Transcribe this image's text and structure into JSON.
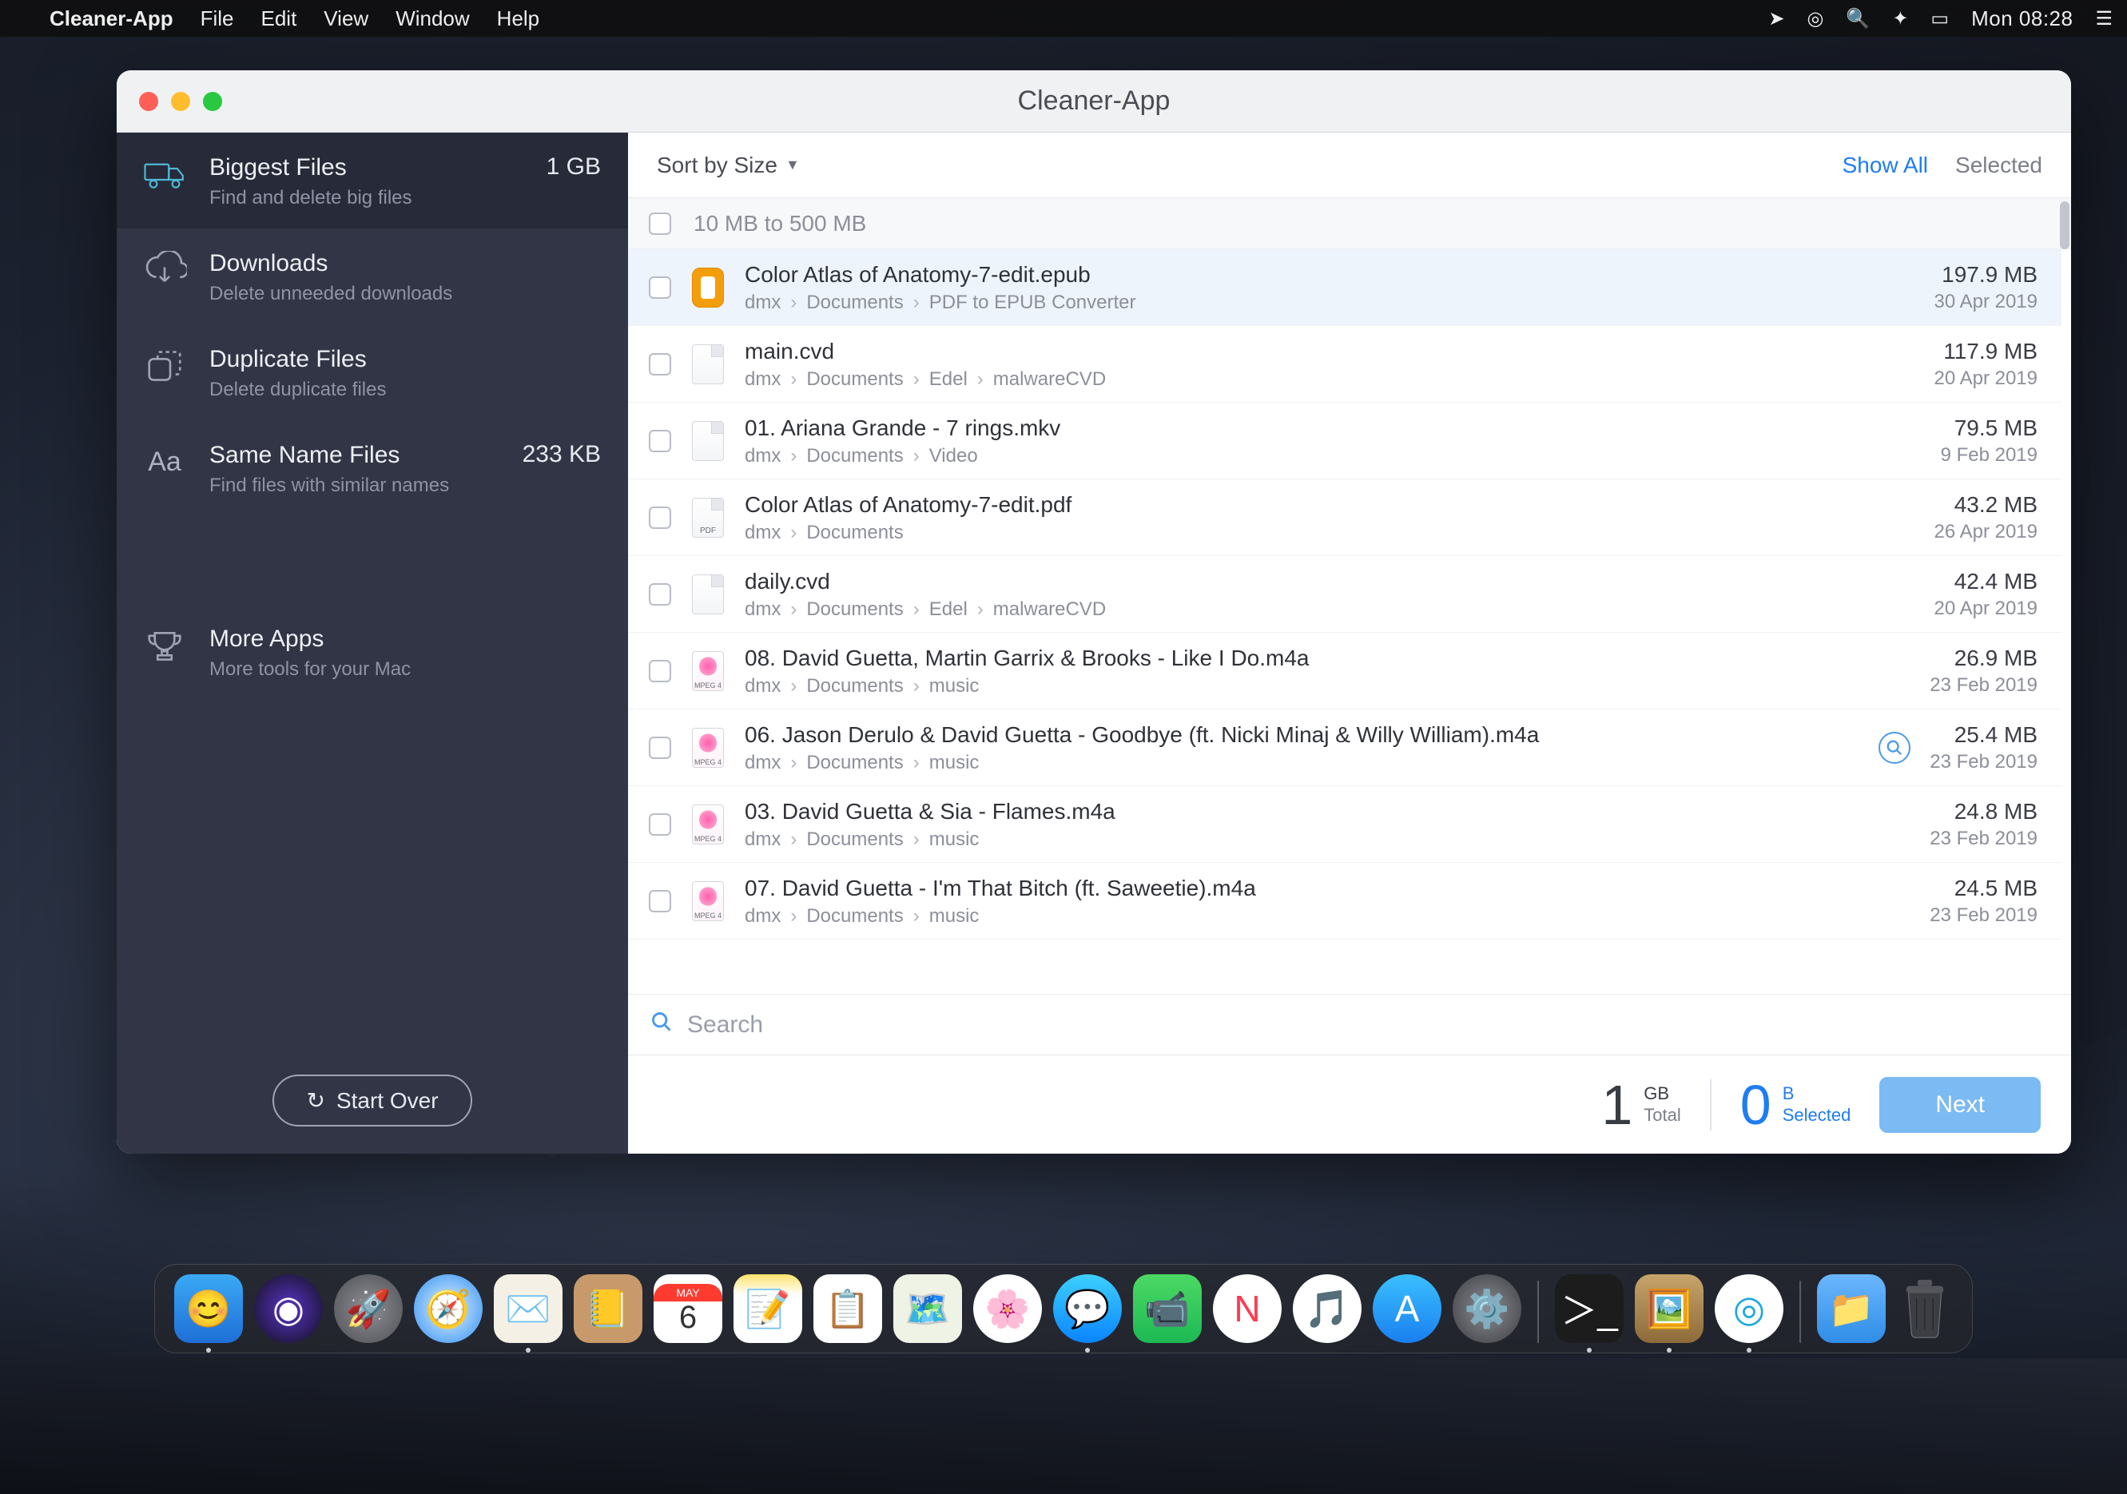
{
  "menubar": {
    "app": "Cleaner-App",
    "items": [
      "File",
      "Edit",
      "View",
      "Window",
      "Help"
    ],
    "clock": "Mon 08:28"
  },
  "window": {
    "title": "Cleaner-App"
  },
  "sidebar": {
    "items": [
      {
        "title": "Biggest Files",
        "subtitle": "Find and delete big files",
        "meta": "1 GB",
        "icon": "truck",
        "active": true
      },
      {
        "title": "Downloads",
        "subtitle": "Delete unneeded downloads",
        "meta": "",
        "icon": "cloud-download",
        "active": false
      },
      {
        "title": "Duplicate Files",
        "subtitle": "Delete duplicate files",
        "meta": "",
        "icon": "duplicate",
        "active": false
      },
      {
        "title": "Same Name Files",
        "subtitle": "Find files with similar names",
        "meta": "233 KB",
        "icon": "aa",
        "active": false
      }
    ],
    "more": {
      "title": "More Apps",
      "subtitle": "More tools for your Mac"
    },
    "start_over": "Start Over"
  },
  "toolbar": {
    "sort_label": "Sort by Size",
    "show_all": "Show All",
    "selected": "Selected"
  },
  "group_header": "10 MB to 500 MB",
  "files": [
    {
      "name": "Color Atlas of Anatomy-7-edit.epub",
      "path": [
        "dmx",
        "Documents",
        "PDF to EPUB Converter"
      ],
      "size": "197.9 MB",
      "date": "30 Apr 2019",
      "kind": "epub",
      "selected": true
    },
    {
      "name": "main.cvd",
      "path": [
        "dmx",
        "Documents",
        "Edel",
        "malwareCVD"
      ],
      "size": "117.9 MB",
      "date": "20 Apr 2019",
      "kind": "doc"
    },
    {
      "name": "01. Ariana Grande - 7 rings.mkv",
      "path": [
        "dmx",
        "Documents",
        "Video"
      ],
      "size": "79.5 MB",
      "date": "9 Feb 2019",
      "kind": "doc"
    },
    {
      "name": "Color Atlas of Anatomy-7-edit.pdf",
      "path": [
        "dmx",
        "Documents"
      ],
      "size": "43.2 MB",
      "date": "26 Apr 2019",
      "kind": "pdf"
    },
    {
      "name": "daily.cvd",
      "path": [
        "dmx",
        "Documents",
        "Edel",
        "malwareCVD"
      ],
      "size": "42.4 MB",
      "date": "20 Apr 2019",
      "kind": "doc"
    },
    {
      "name": "08. David Guetta, Martin Garrix & Brooks - Like I Do.m4a",
      "path": [
        "dmx",
        "Documents",
        "music"
      ],
      "size": "26.9 MB",
      "date": "23 Feb 2019",
      "kind": "audio"
    },
    {
      "name": "06. Jason Derulo & David Guetta - Goodbye (ft. Nicki Minaj & Willy William).m4a",
      "path": [
        "dmx",
        "Documents",
        "music"
      ],
      "size": "25.4 MB",
      "date": "23 Feb 2019",
      "kind": "audio",
      "quicklook": true
    },
    {
      "name": "03. David Guetta & Sia - Flames.m4a",
      "path": [
        "dmx",
        "Documents",
        "music"
      ],
      "size": "24.8 MB",
      "date": "23 Feb 2019",
      "kind": "audio"
    },
    {
      "name": "07. David Guetta - I'm That Bitch (ft. Saweetie).m4a",
      "path": [
        "dmx",
        "Documents",
        "music"
      ],
      "size": "24.5 MB",
      "date": "23 Feb 2019",
      "kind": "audio"
    }
  ],
  "search": {
    "placeholder": "Search"
  },
  "footer": {
    "total_value": "1",
    "total_unit": "GB",
    "total_label": "Total",
    "selected_value": "0",
    "selected_unit": "B",
    "selected_label": "Selected",
    "next": "Next"
  },
  "dock_apps": [
    "finder",
    "siri",
    "launchpad",
    "safari",
    "mail",
    "contacts",
    "calendar",
    "notes",
    "reminders",
    "maps",
    "photos",
    "messages",
    "facetime",
    "news",
    "music",
    "appstore",
    "settings"
  ],
  "dock_right": [
    "terminal",
    "preview",
    "broadcast"
  ],
  "dock_folder": "downloads"
}
